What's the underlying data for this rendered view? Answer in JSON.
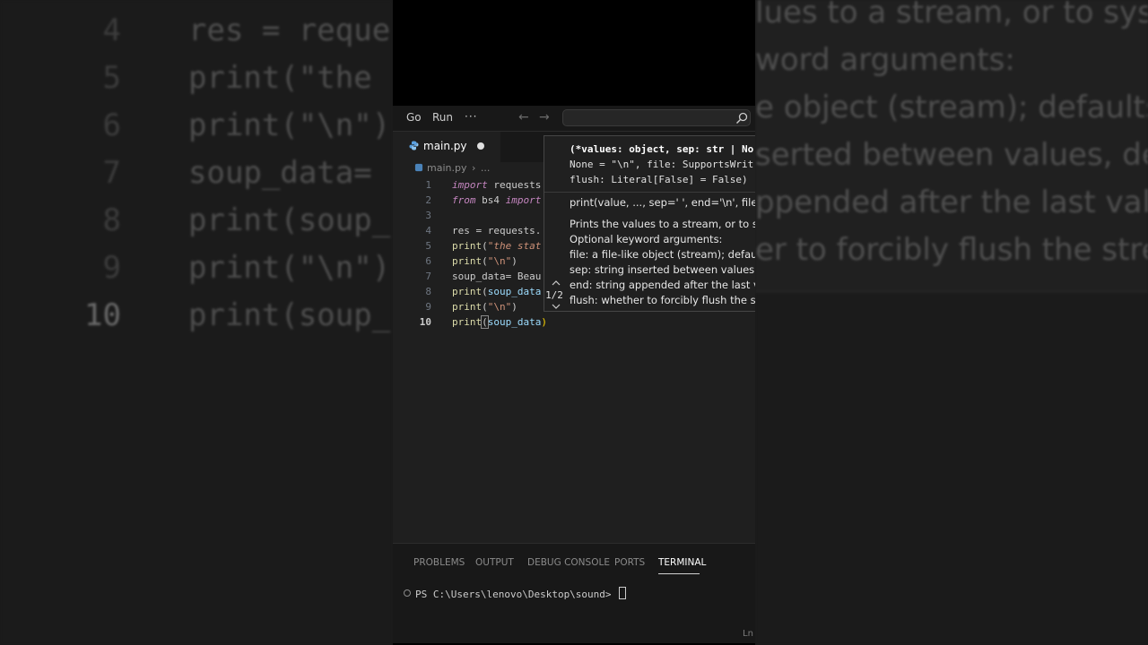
{
  "menu": {
    "go": "Go",
    "run": "Run",
    "more": "···"
  },
  "nav": {
    "back": "←",
    "forward": "→"
  },
  "tab": {
    "label": "main.py"
  },
  "breadcrumb": {
    "file": "main.py",
    "sep": "›",
    "rest": "..."
  },
  "code_lines": [
    {
      "num": "1",
      "parts": [
        {
          "t": "import",
          "c": "kw"
        },
        {
          "t": " requests",
          "c": ""
        }
      ]
    },
    {
      "num": "2",
      "parts": [
        {
          "t": "from",
          "c": "kw"
        },
        {
          "t": " bs4 ",
          "c": ""
        },
        {
          "t": "import",
          "c": "kw"
        }
      ]
    },
    {
      "num": "3",
      "parts": []
    },
    {
      "num": "4",
      "parts": [
        {
          "t": "res = requests.",
          "c": ""
        }
      ]
    },
    {
      "num": "5",
      "parts": [
        {
          "t": "print",
          "c": "fn"
        },
        {
          "t": "(",
          "c": ""
        },
        {
          "t": "\"the stat",
          "c": "strit"
        }
      ]
    },
    {
      "num": "6",
      "parts": [
        {
          "t": "print",
          "c": "fn"
        },
        {
          "t": "(",
          "c": ""
        },
        {
          "t": "\"\\n\"",
          "c": "str"
        },
        {
          "t": ")",
          "c": ""
        }
      ]
    },
    {
      "num": "7",
      "parts": [
        {
          "t": "soup_data= Beau",
          "c": ""
        }
      ]
    },
    {
      "num": "8",
      "parts": [
        {
          "t": "print",
          "c": "fn"
        },
        {
          "t": "(",
          "c": ""
        },
        {
          "t": "soup_data",
          "c": "var"
        }
      ]
    },
    {
      "num": "9",
      "parts": [
        {
          "t": "print",
          "c": "fn"
        },
        {
          "t": "(",
          "c": ""
        },
        {
          "t": "\"\\n\"",
          "c": "str"
        },
        {
          "t": ")",
          "c": ""
        }
      ]
    },
    {
      "num": "10",
      "parts": [
        {
          "t": "print",
          "c": "fn"
        },
        {
          "t": "(",
          "c": "bracket-box"
        },
        {
          "t": "soup_data",
          "c": "var"
        },
        {
          "t": ")",
          "c": "paren"
        }
      ]
    }
  ],
  "hover": {
    "sig_line1": "(*values: object, sep: str | No",
    "sig_line2": "None = \"\\n\", file: SupportsWrit",
    "sig_line3": "flush: Literal[False] = False)",
    "doc_sig": "print(value, ..., sep=' ', end='\\n', file=sy",
    "doc_intro": "Prints the values to a stream, or to sys",
    "doc_opt": "Optional keyword arguments:",
    "doc_file": "file:  a file-like object (stream); defaults",
    "doc_sep": "sep:   string inserted between values, de",
    "doc_end": "end:   string appended after the last val",
    "doc_flush": "flush: whether to forcibly flush the stre",
    "pager": "1/2"
  },
  "panel": {
    "tabs": [
      "PROBLEMS",
      "OUTPUT",
      "DEBUG CONSOLE",
      "PORTS",
      "TERMINAL"
    ],
    "active_tab": "TERMINAL",
    "terminal_prompt": "PS C:\\Users\\lenovo\\Desktop\\sound> "
  },
  "status": {
    "ln": "Ln"
  },
  "background": {
    "left_lines": [
      {
        "num": "4",
        "text": "res = reque"
      },
      {
        "num": "5",
        "text": "print(\"the"
      },
      {
        "num": "6",
        "text": "print(\"\\n\")"
      },
      {
        "num": "7",
        "text": "soup_data="
      },
      {
        "num": "8",
        "text": "print(soup_"
      },
      {
        "num": "9",
        "text": "print(\"\\n\")"
      },
      {
        "num": "10",
        "text": "print(soup_"
      }
    ],
    "right_lines": [
      "lues to a stream, or to sys",
      "word arguments:",
      "e object (stream); defaults",
      "serted between values, de",
      "ppended after the last val",
      "er to forcibly flush the stre"
    ]
  }
}
